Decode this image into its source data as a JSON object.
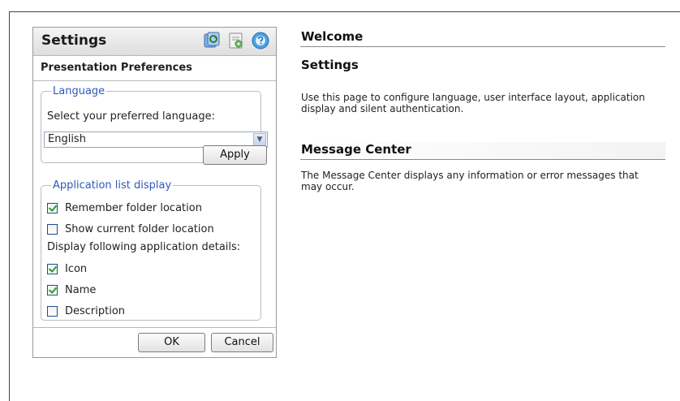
{
  "settings_panel": {
    "title": "Settings",
    "header_icons": [
      "refresh-apps-icon",
      "preferences-icon",
      "help-icon"
    ],
    "subheading": "Presentation Preferences",
    "language": {
      "legend": "Language",
      "prompt": "Select your preferred language:",
      "selected": "English",
      "apply_label": "Apply"
    },
    "app_list": {
      "legend": "Application list display",
      "remember_folder": {
        "label": "Remember folder location",
        "checked": true
      },
      "show_folder": {
        "label": "Show current folder location",
        "checked": false
      },
      "details_prompt": "Display following application details:",
      "icon": {
        "label": "Icon",
        "checked": true
      },
      "name": {
        "label": "Name",
        "checked": true
      },
      "description": {
        "label": "Description",
        "checked": false
      }
    },
    "ok_label": "OK",
    "cancel_label": "Cancel"
  },
  "content": {
    "welcome_title": "Welcome",
    "settings_title": "Settings",
    "settings_text": "Use this page to configure language, user interface layout, application display and silent authentication.",
    "message_center_title": "Message Center",
    "message_center_text": "The Message Center displays any information or error messages that may occur."
  },
  "colors": {
    "legend": "#2f59b8",
    "check": "#21a121"
  }
}
